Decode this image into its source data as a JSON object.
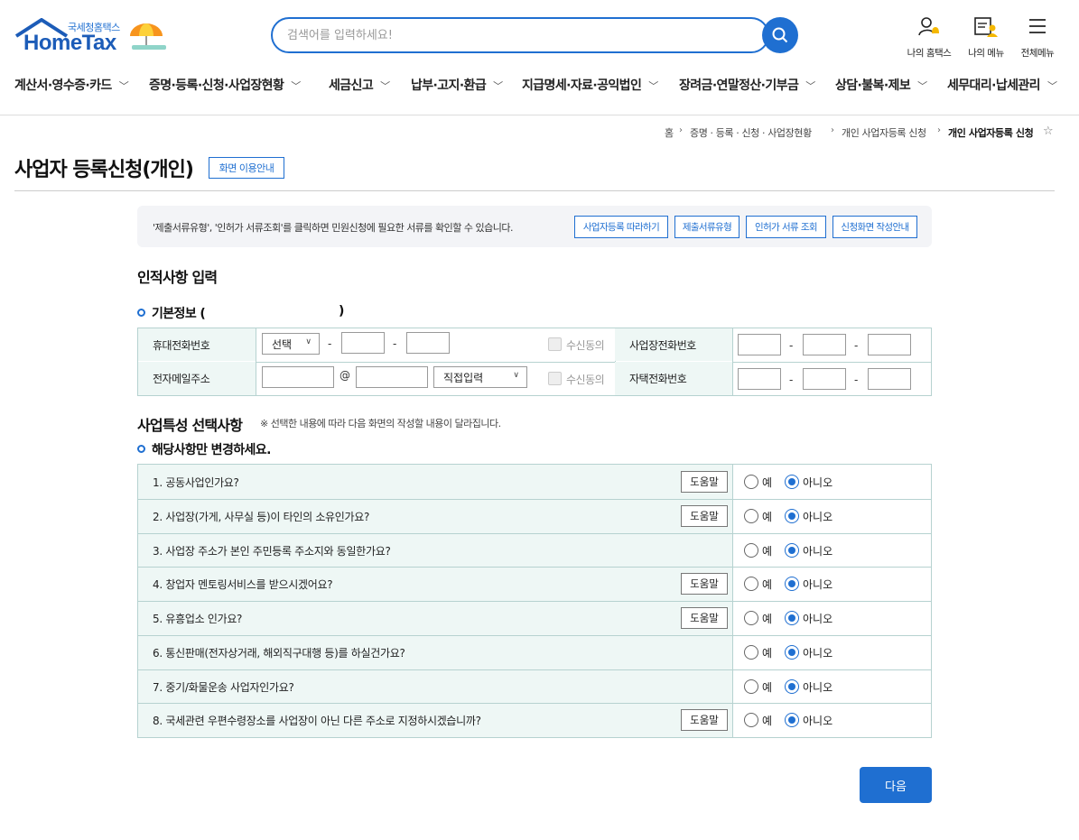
{
  "header": {
    "logo_small": "국세청홈택스",
    "logo_big": "HomeTax",
    "search_placeholder": "검색어를 입력하세요!",
    "icons": [
      {
        "label": "나의 홈택스",
        "icon": "user-bell-icon"
      },
      {
        "label": "나의 메뉴",
        "icon": "menu-user-icon"
      },
      {
        "label": "전체메뉴",
        "icon": "hamburger-icon"
      }
    ]
  },
  "gnb": [
    "계산서·영수증·카드",
    "증명·등록·신청·사업장현황",
    "세금신고",
    "납부·고지·환급",
    "지급명세·자료·공익법인",
    "장려금·연말정산·기부금",
    "상담·불복·제보",
    "세무대리·납세관리"
  ],
  "breadcrumb": [
    "홈",
    "증명 · 등록 · 신청 · 사업장현황",
    "개인 사업자등록 신청",
    "개인 사업자등록 신청"
  ],
  "page": {
    "title": "사업자 등록신청(개인)",
    "guide_button": "화면 이용안내"
  },
  "info": {
    "text": "'제출서류유형', '인허가 서류조회'를 클릭하면 민원신청에 필요한 서류를 확인할 수 있습니다.",
    "buttons": [
      "사업자등록 따라하기",
      "제출서류유형",
      "인허가 서류 조회",
      "신청화면 작성안내"
    ]
  },
  "personal": {
    "section_title": "인적사항 입력",
    "basic_title": "기본정보 (",
    "basic_title_close": ")",
    "mobile_label": "휴대전화번호",
    "mobile_select": "선택",
    "email_label": "전자메일주소",
    "email_at": "@",
    "email_select": "직접입력",
    "consent_label": "수신동의",
    "biz_phone_label": "사업장전화번호",
    "home_phone_label": "자택전화번호",
    "dash": "-"
  },
  "business": {
    "section_title": "사업특성 선택사항",
    "note": "※ 선택한 내용에 따라 다음 화면의 작성할 내용이 달라집니다.",
    "sub_title": "해당사항만 변경하세요.",
    "help_label": "도움말",
    "yes_label": "예",
    "no_label": "아니오",
    "questions": [
      {
        "text": "1. 공동사업인가요?",
        "help": true,
        "answer": "no"
      },
      {
        "text": "2. 사업장(가게, 사무실 등)이 타인의 소유인가요?",
        "help": true,
        "answer": "no"
      },
      {
        "text": "3. 사업장 주소가 본인 주민등록 주소지와 동일한가요?",
        "help": false,
        "answer": "no"
      },
      {
        "text": "4. 창업자 멘토링서비스를 받으시겠어요?",
        "help": true,
        "answer": "no"
      },
      {
        "text": "5. 유흥업소 인가요?",
        "help": true,
        "answer": "no"
      },
      {
        "text": "6. 통신판매(전자상거래, 해외직구대행 등)를 하실건가요?",
        "help": false,
        "answer": "no"
      },
      {
        "text": "7. 중기/화물운송 사업자인가요?",
        "help": false,
        "answer": "no"
      },
      {
        "text": "8. 국세관련 우편수령장소를 사업장이 아닌 다른 주소로 지정하시겠습니까?",
        "help": true,
        "answer": "no"
      }
    ]
  },
  "footer": {
    "next_button": "다음"
  },
  "colors": {
    "accent": "#1f6fd1",
    "label_bg": "#eef7f5",
    "border": "#b6d2d0"
  }
}
